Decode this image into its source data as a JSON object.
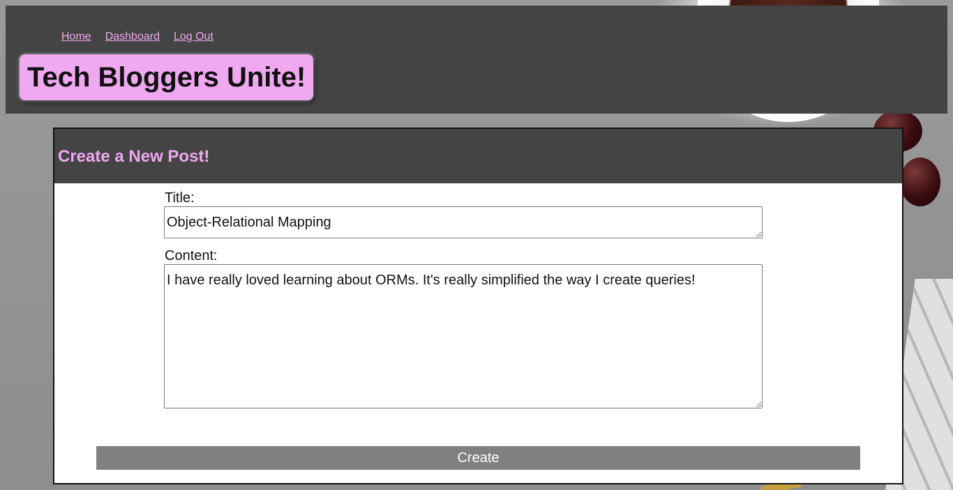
{
  "nav": {
    "items": [
      {
        "label": "Home"
      },
      {
        "label": "Dashboard"
      },
      {
        "label": "Log Out"
      }
    ]
  },
  "brand": {
    "title": "Tech Bloggers Unite!"
  },
  "form": {
    "heading": "Create a New Post!",
    "title_label": "Title:",
    "title_value": "Object-Relational Mapping",
    "content_label": "Content:",
    "content_value": "I have really loved learning about ORMs. It's really simplified the way I create queries!",
    "submit_label": "Create"
  },
  "colors": {
    "accent_pink": "#f0a8f0",
    "header_gray": "#444444",
    "button_gray": "#808080"
  }
}
